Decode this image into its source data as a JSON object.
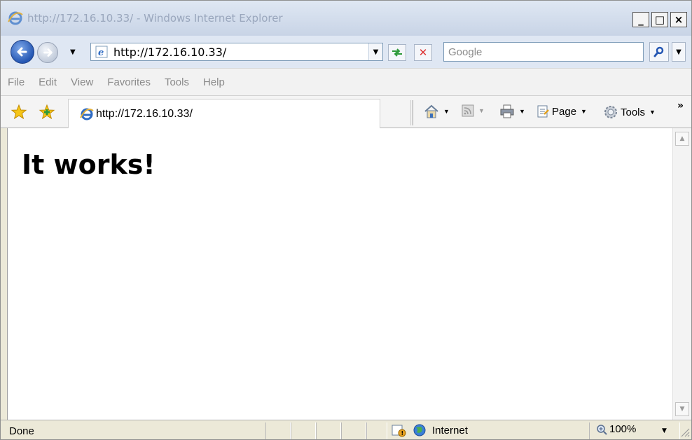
{
  "window": {
    "title": "http://172.16.10.33/ - Windows Internet Explorer",
    "minimize": "_",
    "maximize": "□",
    "close": "×"
  },
  "navigation": {
    "address": "http://172.16.10.33/",
    "search_placeholder": "Google",
    "back_icon": "back-arrow-icon",
    "forward_icon": "forward-arrow-icon"
  },
  "menu": {
    "items": [
      "File",
      "Edit",
      "View",
      "Favorites",
      "Tools",
      "Help"
    ]
  },
  "tabs": [
    {
      "label": "http://172.16.10.33/"
    }
  ],
  "command_bar": {
    "page_label": "Page",
    "tools_label": "Tools",
    "more": "»"
  },
  "page": {
    "heading": "It works!"
  },
  "status": {
    "text": "Done",
    "zone": "Internet",
    "zoom": "100%"
  },
  "colors": {
    "titlebar": "#c8d4e6",
    "chrome": "#ece9d8",
    "accent_blue": "#2557b3"
  }
}
